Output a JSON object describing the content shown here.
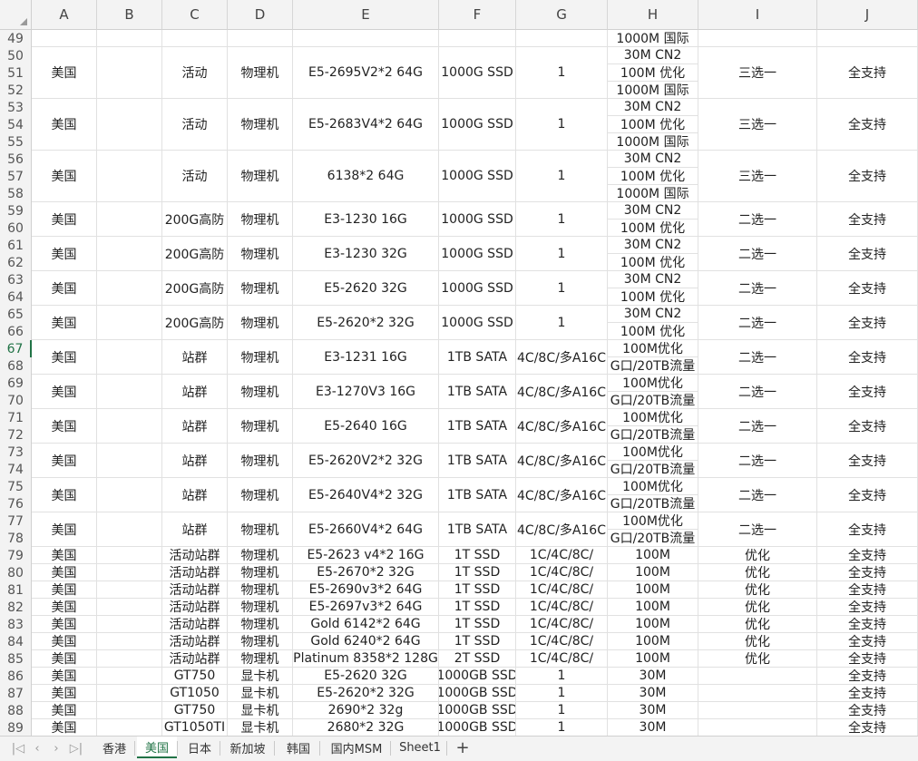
{
  "columns": [
    "A",
    "B",
    "C",
    "D",
    "E",
    "F",
    "G",
    "H",
    "I",
    "J"
  ],
  "row_numbers": [
    "49",
    "50",
    "51",
    "52",
    "53",
    "54",
    "55",
    "56",
    "57",
    "58",
    "59",
    "60",
    "61",
    "62",
    "63",
    "64",
    "65",
    "66",
    "67",
    "68",
    "69",
    "70",
    "71",
    "72",
    "73",
    "74",
    "75",
    "76",
    "77",
    "78",
    "79",
    "80",
    "81",
    "82",
    "83",
    "84",
    "85",
    "86",
    "87",
    "88",
    "89"
  ],
  "active_row": "67",
  "row49_h": "1000M 国际",
  "blocks": [
    {
      "rows": [
        50,
        52
      ],
      "a": "美国",
      "c": "活动",
      "d": "物理机",
      "e": "E5-2695V2*2 64G",
      "f": "1000G SSD",
      "g": "1",
      "h": [
        "30M CN2",
        "100M 优化",
        "1000M 国际"
      ],
      "i": "三选一",
      "j": "全支持"
    },
    {
      "rows": [
        53,
        55
      ],
      "a": "美国",
      "c": "活动",
      "d": "物理机",
      "e": "E5-2683V4*2 64G",
      "f": "1000G SSD",
      "g": "1",
      "h": [
        "30M CN2",
        "100M 优化",
        "1000M 国际"
      ],
      "i": "三选一",
      "j": "全支持"
    },
    {
      "rows": [
        56,
        58
      ],
      "a": "美国",
      "c": "活动",
      "d": "物理机",
      "e": "6138*2 64G",
      "f": "1000G SSD",
      "g": "1",
      "h": [
        "30M CN2",
        "100M 优化",
        "1000M 国际"
      ],
      "i": "三选一",
      "j": "全支持"
    },
    {
      "rows": [
        59,
        60
      ],
      "a": "美国",
      "c": "200G高防",
      "d": "物理机",
      "e": "E3-1230 16G",
      "f": "1000G SSD",
      "g": "1",
      "h": [
        "30M CN2",
        "100M 优化"
      ],
      "i": "二选一",
      "j": "全支持"
    },
    {
      "rows": [
        61,
        62
      ],
      "a": "美国",
      "c": "200G高防",
      "d": "物理机",
      "e": "E3-1230 32G",
      "f": "1000G SSD",
      "g": "1",
      "h": [
        "30M CN2",
        "100M 优化"
      ],
      "i": "二选一",
      "j": "全支持"
    },
    {
      "rows": [
        63,
        64
      ],
      "a": "美国",
      "c": "200G高防",
      "d": "物理机",
      "e": "E5-2620 32G",
      "f": "1000G SSD",
      "g": "1",
      "h": [
        "30M CN2",
        "100M 优化"
      ],
      "i": "二选一",
      "j": "全支持"
    },
    {
      "rows": [
        65,
        66
      ],
      "a": "美国",
      "c": "200G高防",
      "d": "物理机",
      "e": "E5-2620*2 32G",
      "f": "1000G SSD",
      "g": "1",
      "h": [
        "30M CN2",
        "100M 优化"
      ],
      "i": "二选一",
      "j": "全支持"
    },
    {
      "rows": [
        67,
        68
      ],
      "a": "美国",
      "c": "站群",
      "d": "物理机",
      "e": "E3-1231 16G",
      "f": "1TB SATA",
      "g": "4C/8C/多A16C",
      "h": [
        "100M优化",
        "G口/20TB流量"
      ],
      "i": "二选一",
      "j": "全支持"
    },
    {
      "rows": [
        69,
        70
      ],
      "a": "美国",
      "c": "站群",
      "d": "物理机",
      "e": "E3-1270V3 16G",
      "f": "1TB SATA",
      "g": "4C/8C/多A16C",
      "h": [
        "100M优化",
        "G口/20TB流量"
      ],
      "i": "二选一",
      "j": "全支持"
    },
    {
      "rows": [
        71,
        72
      ],
      "a": "美国",
      "c": "站群",
      "d": "物理机",
      "e": "E5-2640 16G",
      "f": "1TB SATA",
      "g": "4C/8C/多A16C",
      "h": [
        "100M优化",
        "G口/20TB流量"
      ],
      "i": "二选一",
      "j": "全支持"
    },
    {
      "rows": [
        73,
        74
      ],
      "a": "美国",
      "c": "站群",
      "d": "物理机",
      "e": "E5-2620V2*2 32G",
      "f": "1TB SATA",
      "g": "4C/8C/多A16C",
      "h": [
        "100M优化",
        "G口/20TB流量"
      ],
      "i": "二选一",
      "j": "全支持"
    },
    {
      "rows": [
        75,
        76
      ],
      "a": "美国",
      "c": "站群",
      "d": "物理机",
      "e": "E5-2640V4*2 32G",
      "f": "1TB SATA",
      "g": "4C/8C/多A16C",
      "h": [
        "100M优化",
        "G口/20TB流量"
      ],
      "i": "二选一",
      "j": "全支持"
    },
    {
      "rows": [
        77,
        78
      ],
      "a": "美国",
      "c": "站群",
      "d": "物理机",
      "e": "E5-2660V4*2 64G",
      "f": "1TB SATA",
      "g": "4C/8C/多A16C",
      "h": [
        "100M优化",
        "G口/20TB流量"
      ],
      "i": "二选一",
      "j": "全支持"
    }
  ],
  "simple_rows": [
    {
      "row": 79,
      "a": "美国",
      "c": "活动站群",
      "d": "物理机",
      "e": "E5-2623 v4*2 16G",
      "f": "1T SSD",
      "g": "1C/4C/8C/",
      "h": "100M",
      "i": "优化",
      "j": "全支持"
    },
    {
      "row": 80,
      "a": "美国",
      "c": "活动站群",
      "d": "物理机",
      "e": "E5-2670*2 32G",
      "f": "1T SSD",
      "g": "1C/4C/8C/",
      "h": "100M",
      "i": "优化",
      "j": "全支持"
    },
    {
      "row": 81,
      "a": "美国",
      "c": "活动站群",
      "d": "物理机",
      "e": "E5-2690v3*2 64G",
      "f": "1T SSD",
      "g": "1C/4C/8C/",
      "h": "100M",
      "i": "优化",
      "j": "全支持"
    },
    {
      "row": 82,
      "a": "美国",
      "c": "活动站群",
      "d": "物理机",
      "e": "E5-2697v3*2 64G",
      "f": "1T SSD",
      "g": "1C/4C/8C/",
      "h": "100M",
      "i": "优化",
      "j": "全支持"
    },
    {
      "row": 83,
      "a": "美国",
      "c": "活动站群",
      "d": "物理机",
      "e": "Gold 6142*2 64G",
      "f": "1T SSD",
      "g": "1C/4C/8C/",
      "h": "100M",
      "i": "优化",
      "j": "全支持"
    },
    {
      "row": 84,
      "a": "美国",
      "c": "活动站群",
      "d": "物理机",
      "e": "Gold 6240*2 64G",
      "f": "1T SSD",
      "g": "1C/4C/8C/",
      "h": "100M",
      "i": "优化",
      "j": "全支持"
    },
    {
      "row": 85,
      "a": "美国",
      "c": "活动站群",
      "d": "物理机",
      "e": "Platinum 8358*2 128G",
      "f": "2T SSD",
      "g": "1C/4C/8C/",
      "h": "100M",
      "i": "优化",
      "j": "全支持"
    },
    {
      "row": 86,
      "a": "美国",
      "c": "GT750",
      "d": "显卡机",
      "e": "E5-2620 32G",
      "f": "1000GB SSD",
      "g": "1",
      "h": "30M",
      "i": "",
      "j": "全支持"
    },
    {
      "row": 87,
      "a": "美国",
      "c": "GT1050",
      "d": "显卡机",
      "e": "E5-2620*2 32G",
      "f": "1000GB SSD",
      "g": "1",
      "h": "30M",
      "i": "",
      "j": "全支持"
    },
    {
      "row": 88,
      "a": "美国",
      "c": "GT750",
      "d": "显卡机",
      "e": "2690*2 32g",
      "f": "1000GB SSD",
      "g": "1",
      "h": "30M",
      "i": "",
      "j": "全支持"
    },
    {
      "row": 89,
      "a": "美国",
      "c": "GT1050TI",
      "d": "显卡机",
      "e": "2680*2 32G",
      "f": "1000GB SSD",
      "g": "1",
      "h": "30M",
      "i": "",
      "j": "全支持"
    }
  ],
  "nav_icons": [
    "first-sheet-icon",
    "prev-sheet-icon",
    "next-sheet-icon",
    "last-sheet-icon"
  ],
  "nav_glyphs": [
    "|◁",
    "‹",
    "›",
    "▷|"
  ],
  "tabs": [
    "香港",
    "美国",
    "日本",
    "新加坡",
    "韩国",
    "国内MSM",
    "Sheet1"
  ],
  "active_tab": "美国",
  "add_sheet_glyph": "+",
  "colors": {
    "accent": "#217346",
    "header_bg": "#f3f3f3",
    "grid": "#e1e1e1"
  }
}
